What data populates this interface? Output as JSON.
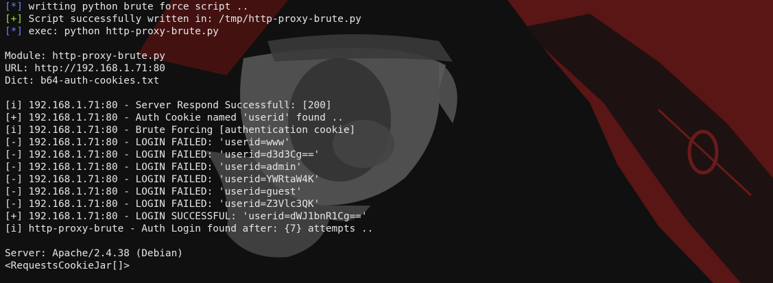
{
  "terminal": {
    "lines": [
      {
        "prefix": "[*]",
        "style": "info",
        "text": " writting python brute force script .."
      },
      {
        "prefix": "[+]",
        "style": "ok",
        "text": " Script successfully written in: /tmp/http-proxy-brute.py"
      },
      {
        "prefix": "[*]",
        "style": "info",
        "text": " exec: python http-proxy-brute.py"
      },
      {
        "prefix": "",
        "style": "plain",
        "text": ""
      },
      {
        "prefix": "",
        "style": "plain",
        "text": "Module: http-proxy-brute.py"
      },
      {
        "prefix": "",
        "style": "plain",
        "text": "URL: http://192.168.1.71:80"
      },
      {
        "prefix": "",
        "style": "plain",
        "text": "Dict: b64-auth-cookies.txt"
      },
      {
        "prefix": "",
        "style": "plain",
        "text": ""
      },
      {
        "prefix": "",
        "style": "plain",
        "text": "[i] 192.168.1.71:80 - Server Respond Successfull: [200]"
      },
      {
        "prefix": "",
        "style": "plain",
        "text": "[+] 192.168.1.71:80 - Auth Cookie named 'userid' found .."
      },
      {
        "prefix": "",
        "style": "plain",
        "text": "[i] 192.168.1.71:80 - Brute Forcing [authentication cookie]"
      },
      {
        "prefix": "",
        "style": "plain",
        "text": "[-] 192.168.1.71:80 - LOGIN FAILED: 'userid=www'"
      },
      {
        "prefix": "",
        "style": "plain",
        "text": "[-] 192.168.1.71:80 - LOGIN FAILED: 'userid=d3d3Cg=='"
      },
      {
        "prefix": "",
        "style": "plain",
        "text": "[-] 192.168.1.71:80 - LOGIN FAILED: 'userid=admin'"
      },
      {
        "prefix": "",
        "style": "plain",
        "text": "[-] 192.168.1.71:80 - LOGIN FAILED: 'userid=YWRtaW4K'"
      },
      {
        "prefix": "",
        "style": "plain",
        "text": "[-] 192.168.1.71:80 - LOGIN FAILED: 'userid=guest'"
      },
      {
        "prefix": "",
        "style": "plain",
        "text": "[-] 192.168.1.71:80 - LOGIN FAILED: 'userid=Z3Vlc3QK'"
      },
      {
        "prefix": "",
        "style": "plain",
        "text": "[+] 192.168.1.71:80 - LOGIN SUCCESSFUL: 'userid=dWJ1bnR1Cg=='"
      },
      {
        "prefix": "",
        "style": "plain",
        "text": "[i] http-proxy-brute - Auth Login found after: {7} attempts .."
      },
      {
        "prefix": "",
        "style": "plain",
        "text": ""
      },
      {
        "prefix": "",
        "style": "plain",
        "text": "Server: Apache/2.4.38 (Debian)"
      },
      {
        "prefix": "",
        "style": "plain",
        "text": "<RequestsCookieJar[]>"
      }
    ]
  },
  "colors": {
    "background": "#101010",
    "text": "#e6e6e6",
    "prefix_info": "#5f87ff",
    "prefix_ok": "#a7df3a",
    "wallpaper_red": "#5a1414",
    "wallpaper_gray": "#5e5e5e"
  }
}
